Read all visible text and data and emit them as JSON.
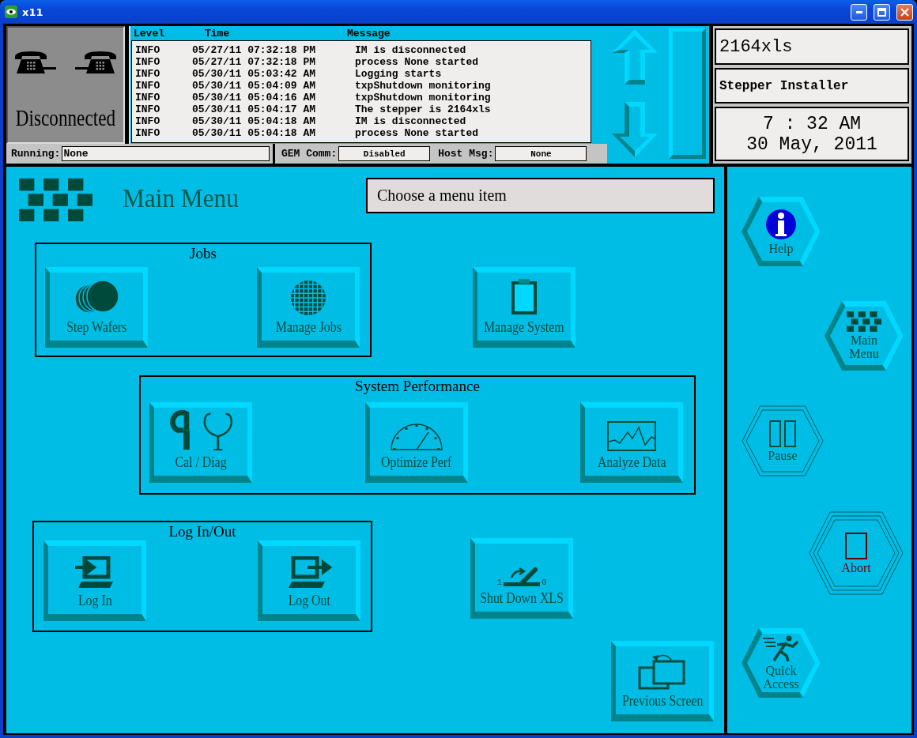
{
  "window": {
    "title": "x11"
  },
  "connection": {
    "status": "Disconnected"
  },
  "log": {
    "columns": [
      "Level",
      "Time",
      "Message"
    ],
    "rows": [
      {
        "level": "INFO",
        "time": "05/27/11 07:32:18 PM",
        "message": "IM is disconnected"
      },
      {
        "level": "INFO",
        "time": "05/27/11 07:32:18 PM",
        "message": "process None started"
      },
      {
        "level": "INFO",
        "time": "05/30/11 05:03:42 AM",
        "message": "Logging starts"
      },
      {
        "level": "INFO",
        "time": "05/30/11 05:04:09 AM",
        "message": "txpShutdown monitoring"
      },
      {
        "level": "INFO",
        "time": "05/30/11 05:04:16 AM",
        "message": "txpShutdown monitoring"
      },
      {
        "level": "INFO",
        "time": "05/30/11 05:04:17 AM",
        "message": "The stepper is 2164xls"
      },
      {
        "level": "INFO",
        "time": "05/30/11 05:04:18 AM",
        "message": "IM is disconnected"
      },
      {
        "level": "INFO",
        "time": "05/30/11 05:04:18 AM",
        "message": "process None started"
      }
    ]
  },
  "status_bar": [
    {
      "label": "Running:",
      "value": "None"
    },
    {
      "label": "GEM Comm:",
      "value": "Disabled"
    },
    {
      "label": "Host Msg:",
      "value": "None"
    }
  ],
  "info": {
    "machine": "2164xls",
    "role": "Stepper Installer",
    "time": "7 : 32 AM",
    "date": "30 May, 2011"
  },
  "main_menu": {
    "title": "Main Menu",
    "message": "Choose a menu item",
    "groups": [
      {
        "title": "Jobs",
        "buttons": [
          {
            "label": "Step Wafers"
          },
          {
            "label": "Manage Jobs"
          }
        ]
      },
      {
        "title": "System Performance",
        "buttons": [
          {
            "label": "Cal / Diag"
          },
          {
            "label": "Optimize Perf"
          },
          {
            "label": "Analyze Data"
          }
        ]
      },
      {
        "title": "Log In/Out",
        "buttons": [
          {
            "label": "Log In"
          },
          {
            "label": "Log Out"
          }
        ]
      }
    ],
    "buttons": [
      {
        "label": "Manage System"
      },
      {
        "label": "Shut Down XLS",
        "marks": [
          "1",
          "0"
        ]
      },
      {
        "label": "Previous Screen"
      }
    ]
  },
  "side_buttons": [
    {
      "label": "Help",
      "kind": "raised"
    },
    {
      "label": "Main Menu",
      "kind": "raised"
    },
    {
      "label": "Pause",
      "kind": "outlined"
    },
    {
      "label": "Abort",
      "kind": "alert"
    },
    {
      "label": "Quick Access",
      "kind": "raised"
    }
  ]
}
